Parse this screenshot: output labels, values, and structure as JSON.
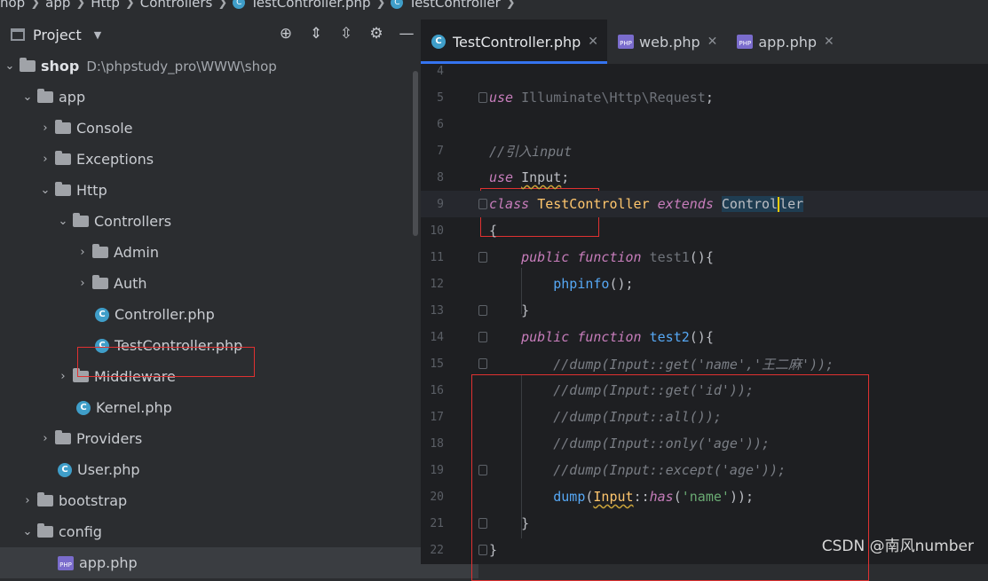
{
  "breadcrumb": [
    "hop",
    "app",
    "Http",
    "Controllers",
    "TestController.php",
    "TestController"
  ],
  "project": {
    "title": "Project"
  },
  "tree": [
    {
      "label": "shop",
      "path": "D:\\phpstudy_pro\\WWW\\shop"
    },
    {
      "label": "app"
    },
    {
      "label": "Console"
    },
    {
      "label": "Exceptions"
    },
    {
      "label": "Http"
    },
    {
      "label": "Controllers"
    },
    {
      "label": "Admin"
    },
    {
      "label": "Auth"
    },
    {
      "label": "Controller.php"
    },
    {
      "label": "TestController.php"
    },
    {
      "label": "Middleware"
    },
    {
      "label": "Kernel.php"
    },
    {
      "label": "Providers"
    },
    {
      "label": "User.php"
    },
    {
      "label": "bootstrap"
    },
    {
      "label": "config"
    },
    {
      "label": "app.php"
    }
  ],
  "tabs": [
    {
      "label": "TestController.php"
    },
    {
      "label": "web.php"
    },
    {
      "label": "app.php"
    }
  ],
  "icons": {
    "c": "C",
    "php": "PHP"
  },
  "code": {
    "lines": [
      {
        "n": "4",
        "segs": []
      },
      {
        "n": "5",
        "segs": [
          {
            "c": "kw",
            "t": "use"
          },
          {
            "c": "dim",
            "t": " Illuminate\\Http\\Request"
          },
          {
            "c": "",
            "t": ";"
          }
        ]
      },
      {
        "n": "6",
        "segs": []
      },
      {
        "n": "7",
        "segs": [
          {
            "c": "cmt",
            "t": "//引入input"
          }
        ]
      },
      {
        "n": "8",
        "segs": [
          {
            "c": "kw",
            "t": "use"
          },
          {
            "c": "",
            "t": " "
          },
          {
            "c": "sq",
            "t": "Input"
          },
          {
            "c": "",
            "t": ";"
          }
        ]
      },
      {
        "n": "9",
        "segs": [
          {
            "c": "kw",
            "t": "class"
          },
          {
            "c": "",
            "t": " "
          },
          {
            "c": "cls",
            "t": "TestController"
          },
          {
            "c": "",
            "t": " "
          },
          {
            "c": "kw",
            "t": "extends"
          },
          {
            "c": "",
            "t": " "
          },
          {
            "c": "hl",
            "t": "Control"
          },
          {
            "c": "cursor",
            "t": ""
          },
          {
            "c": "hl",
            "t": "ler"
          }
        ]
      },
      {
        "n": "10",
        "segs": [
          {
            "c": "",
            "t": "{"
          }
        ]
      },
      {
        "n": "11",
        "segs": [
          {
            "c": "",
            "t": "    "
          },
          {
            "c": "kw",
            "t": "public function"
          },
          {
            "c": "",
            "t": " "
          },
          {
            "c": "dim",
            "t": "test1"
          },
          {
            "c": "",
            "t": "(){"
          }
        ]
      },
      {
        "n": "12",
        "segs": [
          {
            "c": "",
            "t": "        "
          },
          {
            "c": "fn",
            "t": "phpinfo"
          },
          {
            "c": "",
            "t": "();"
          }
        ]
      },
      {
        "n": "13",
        "segs": [
          {
            "c": "",
            "t": "    }"
          }
        ]
      },
      {
        "n": "14",
        "segs": [
          {
            "c": "",
            "t": "    "
          },
          {
            "c": "kw",
            "t": "public function"
          },
          {
            "c": "",
            "t": " "
          },
          {
            "c": "fn",
            "t": "test2"
          },
          {
            "c": "",
            "t": "(){"
          }
        ]
      },
      {
        "n": "15",
        "segs": [
          {
            "c": "",
            "t": "        "
          },
          {
            "c": "cmt",
            "t": "//dump(Input::get('name','王二麻'));"
          }
        ]
      },
      {
        "n": "16",
        "segs": [
          {
            "c": "",
            "t": "        "
          },
          {
            "c": "cmt",
            "t": "//dump(Input::get('id'));"
          }
        ]
      },
      {
        "n": "17",
        "segs": [
          {
            "c": "",
            "t": "        "
          },
          {
            "c": "cmt",
            "t": "//dump(Input::all());"
          }
        ]
      },
      {
        "n": "18",
        "segs": [
          {
            "c": "",
            "t": "        "
          },
          {
            "c": "cmt",
            "t": "//dump(Input::only('age'));"
          }
        ]
      },
      {
        "n": "19",
        "segs": [
          {
            "c": "",
            "t": "        "
          },
          {
            "c": "cmt",
            "t": "//dump(Input::except('age'));"
          }
        ]
      },
      {
        "n": "20",
        "segs": [
          {
            "c": "",
            "t": "        "
          },
          {
            "c": "fn",
            "t": "dump"
          },
          {
            "c": "",
            "t": "("
          },
          {
            "c": "cls sq",
            "t": "Input"
          },
          {
            "c": "",
            "t": "::"
          },
          {
            "c": "kw",
            "t": "has"
          },
          {
            "c": "",
            "t": "("
          },
          {
            "c": "str",
            "t": "'name'"
          },
          {
            "c": "",
            "t": "));"
          }
        ]
      },
      {
        "n": "21",
        "segs": [
          {
            "c": "",
            "t": "    }"
          }
        ]
      },
      {
        "n": "22",
        "segs": [
          {
            "c": "",
            "t": "}"
          }
        ]
      }
    ]
  },
  "watermark": "CSDN @南风number"
}
